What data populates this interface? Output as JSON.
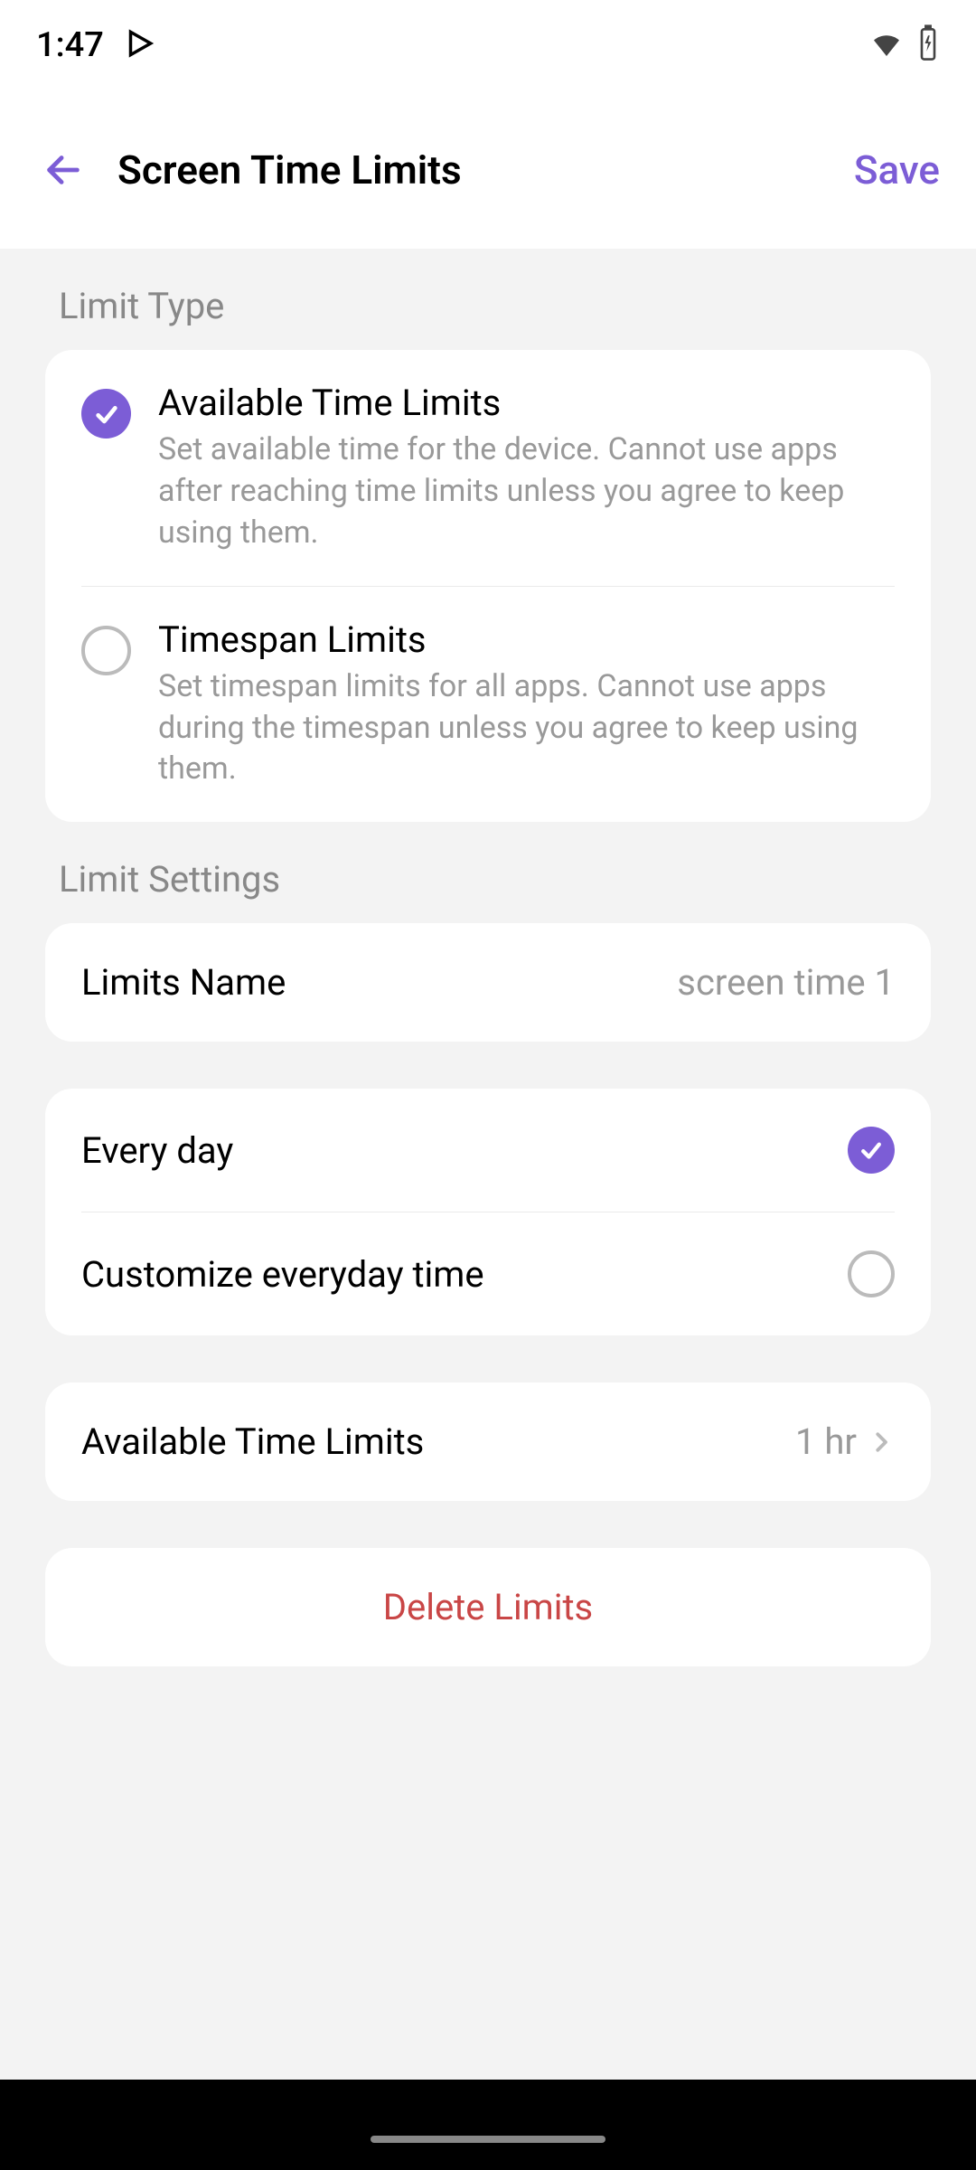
{
  "statusBar": {
    "time": "1:47"
  },
  "header": {
    "title": "Screen Time Limits",
    "saveLabel": "Save"
  },
  "limitType": {
    "sectionTitle": "Limit Type",
    "options": [
      {
        "title": "Available Time Limits",
        "description": "Set available time for the device. Cannot use apps after reaching time limits unless you agree to keep using them.",
        "selected": true
      },
      {
        "title": "Timespan Limits",
        "description": "Set timespan limits for all apps. Cannot use apps during the timespan unless you agree to keep using them.",
        "selected": false
      }
    ]
  },
  "limitSettings": {
    "sectionTitle": "Limit Settings",
    "nameLabel": "Limits Name",
    "nameValue": "screen time 1",
    "scheduleOptions": [
      {
        "label": "Every day",
        "selected": true
      },
      {
        "label": "Customize everyday time",
        "selected": false
      }
    ],
    "timeLimitLabel": "Available Time Limits",
    "timeLimitValue": "1 hr"
  },
  "deleteLabel": "Delete Limits",
  "colors": {
    "accent": "#7C5DD6",
    "danger": "#C94646"
  }
}
